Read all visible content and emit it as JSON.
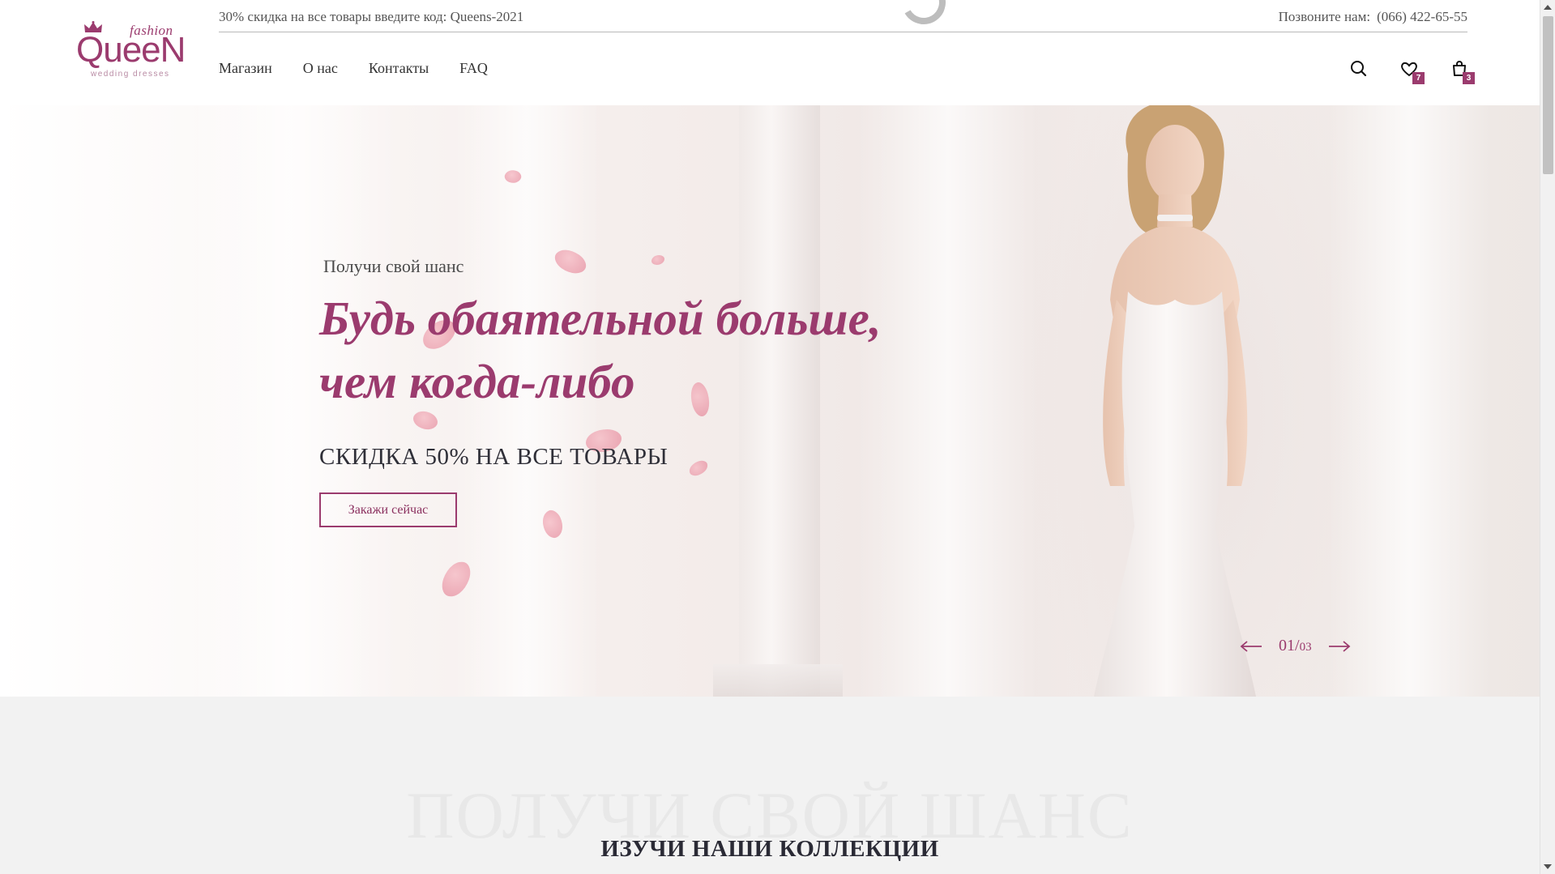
{
  "brand": {
    "fashion": "fashion",
    "name": "QueeN",
    "tagline": "wedding dresses",
    "accent_color": "#9b3b6e"
  },
  "topbar": {
    "promo": "30% скидка на все товары введите код: Queens-2021",
    "phone_label": "Позвоните нам:",
    "phone_number": "(066) 422-65-55"
  },
  "nav": {
    "items": [
      "Магазин",
      "О нас",
      "Контакты",
      "FAQ"
    ]
  },
  "header_icons": {
    "search": "search-icon",
    "wishlist": "heart-icon",
    "wishlist_count": "7",
    "cart": "shopping-bag-icon",
    "cart_count": "3"
  },
  "hero": {
    "subtitle": "Получи свой шанс",
    "title": "Будь обаятельной больше, чем когда-либо",
    "discount": "СКИДКА 50% НА ВСЕ ТОВАРЫ",
    "cta": "Закажи сейчас",
    "slide_current": "01",
    "slide_total": "03"
  },
  "section": {
    "ghost_text": "ПОЛУЧИ СВОЙ ШАНС",
    "title": "ИЗУЧИ НАШИ КОЛЛЕКЦИИ"
  }
}
